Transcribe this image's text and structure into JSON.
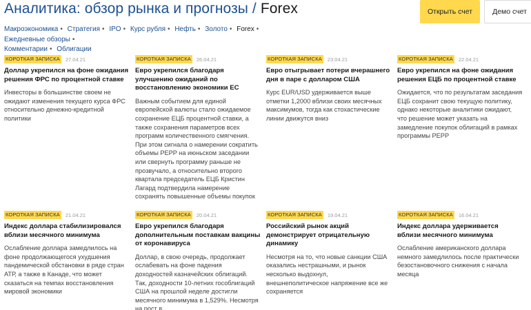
{
  "header": {
    "title": "Аналитика: обзор рынка и прогнозы / ",
    "title_current": "Forex",
    "open_account": "Открыть счет",
    "demo_account": "Демо счет"
  },
  "nav": [
    {
      "label": "Макроэкономика",
      "active": false,
      "sep": true
    },
    {
      "label": "Стратегия",
      "active": false,
      "sep": true
    },
    {
      "label": "IPO",
      "active": false,
      "sep": true
    },
    {
      "label": "Курс рубля",
      "active": false,
      "sep": true
    },
    {
      "label": "Нефть",
      "active": false,
      "sep": true
    },
    {
      "label": "Золото",
      "active": false,
      "sep": true
    },
    {
      "label": "Forex",
      "active": true,
      "sep": true
    },
    {
      "label": "Ежедневные обзоры",
      "active": false,
      "sep": true
    },
    {
      "label": "Комментарии",
      "active": false,
      "sep": true
    },
    {
      "label": "Облигации",
      "active": false,
      "sep": false
    }
  ],
  "cards": [
    {
      "badge": "КОРОТКАЯ ЗАПИСКА",
      "date": "27.04.21",
      "title": "Доллар укрепился на фоне ожидания решения ФРС по процентной ставке",
      "text": "Инвесторы в большинстве своем не ожидают изменения текущего курса ФРС относительно денежно-кредитной политики"
    },
    {
      "badge": "КОРОТКАЯ ЗАПИСКА",
      "date": "26.04.21",
      "title": "Евро укрепился благодаря улучшению ожиданий по восстановлению экономики ЕС",
      "text": "Важным событием для единой европейской валюты стало ожидаемое сохранение ЕЦБ процентной ставки, а также сохранения параметров всех программ количественного смягчения. При этом сигнала о намерении сократить объемы PEPP на июньском заседании или свернуть программу раньше не прозвучало, а относительно второго квартала председатель ЕЦБ Кристин Лагард подтвердила намерение сохранять повышенные объемы покупок"
    },
    {
      "badge": "КОРОТКАЯ ЗАПИСКА",
      "date": "23.04.21",
      "title": "Евро отыгрывает потери вчерашнего дня в паре с долларом США",
      "text": "Курс EUR/USD удерживается выше отметки 1,2000 вблизи своих месячных максимумов, тогда как стохастические линии движутся вниз"
    },
    {
      "badge": "КОРОТКАЯ ЗАПИСКА",
      "date": "22.04.21",
      "title": "Евро укрепился на фоне ожидания решения ЕЦБ по процентной ставке",
      "text": "Ожидается, что по результатам заседания ЕЦБ сохранит свою текущую политику, однако некоторые аналитики ожидают, что решение может указать на замедление покупок облигаций в рамках программы PEPP"
    },
    {
      "badge": "КОРОТКАЯ ЗАПИСКА",
      "date": "21.04.21",
      "title": "Индекс доллара стабилизировался вблизи месячного минимума",
      "text": "Ослабление доллара замедлилось на фоне продолжающегося ухудшения пандемической обстановки в ряде стран АТР, а также в Канаде, что может сказаться на темпах восстановления мировой экономики"
    },
    {
      "badge": "КОРОТКАЯ ЗАПИСКА",
      "date": "20.04.21",
      "title": "Евро укрепился благодаря дополнительным поставкам вакцины от коронавируса",
      "text": "Доллар, в свою очередь, продолжает ослабевать на фоне падения доходностей казначейских облигаций. Так, доходности 10-летних гособлигаций США на прошлой неделе достигли месячного минимума в 1,529%. Несмотря на рост в"
    },
    {
      "badge": "КОРОТКАЯ ЗАПИСКА",
      "date": "19.04.21",
      "title": "Российский рынок акций демонстрирует отрицательную динамику",
      "text": "Несмотря на то, что новые санкции США оказались нестрашными, и рынок несколько выдохнул, внешнеполитическое напряжение все же сохраняется"
    },
    {
      "badge": "КОРОТКАЯ ЗАПИСКА",
      "date": "16.04.21",
      "title": "Индекс доллара удерживается вблизи месячного минимума",
      "text": "Ослабление американского доллара немного замедлилось после практически безостановочного снижения с начала месяца"
    }
  ]
}
